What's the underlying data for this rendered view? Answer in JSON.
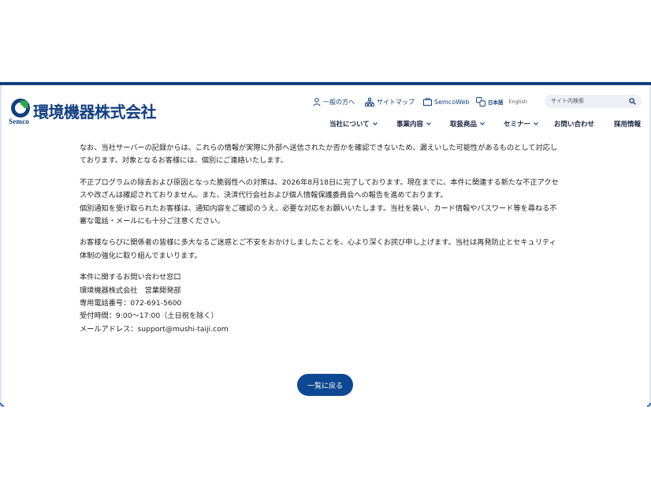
{
  "header": {
    "logo_name": "環境機器株式会社",
    "logo_sub": "Semco",
    "utility": {
      "general": "一般の方へ",
      "sitemap": "サイトマップ",
      "semcoweb": "SemcoWeb",
      "lang_ja": "日本語",
      "lang_en": "English"
    },
    "search": {
      "placeholder": "サイト内検索",
      "value": ""
    },
    "nav": {
      "about": "当社について",
      "business": "事業内容",
      "products": "取扱商品",
      "seminar": "セミナー",
      "contact": "お問い合わせ",
      "recruit": "採用情報"
    }
  },
  "article": {
    "para1": [
      "なお、当社サーバーの記録からは、これらの情報が実際に外部へ送信されたか否かを確認できないため、漏えいした可能性があるものとして対応し",
      "ております。対象となるお客様には、個別にご連絡いたします。"
    ],
    "para2": [
      "不正プログラムの除去および原因となった脆弱性への対策は、2026年8月18日に完了しております。現在までに、本件に関連する新たな不正アクセ",
      "スや改ざんは確認されておりません。また、決済代行会社および個人情報保護委員会への報告を進めております。",
      "個別通知を受け取られたお客様は、通知内容をご確認のうえ、必要な対応をお願いいたします。当社を装い、カード情報やパスワード等を尋ねる不",
      "審な電話・メールにも十分ご注意ください。"
    ],
    "para3": [
      "お客様ならびに関係者の皆様に多大なるご迷惑とご不安をおかけしましたことを、心より深くお詫び申し上げます。当社は再発防止とセキュリティ",
      "体制の強化に取り組んでまいります。"
    ],
    "contact": {
      "heading": "本件に関するお問い合わせ窓口",
      "department": "環境機器株式会社　営業開発部",
      "phone": "専用電話番号：072-691-5600",
      "hours": "受付時間：9:00～17:00（土日祝を除く）",
      "email": "メールアドレス：support@mushi-taiji.com"
    }
  },
  "back_button": "一覧に戻る",
  "colors": {
    "brand_navy": "#123f7e",
    "button_blue": "#0f4892",
    "logo_green": "#2ea84a"
  }
}
